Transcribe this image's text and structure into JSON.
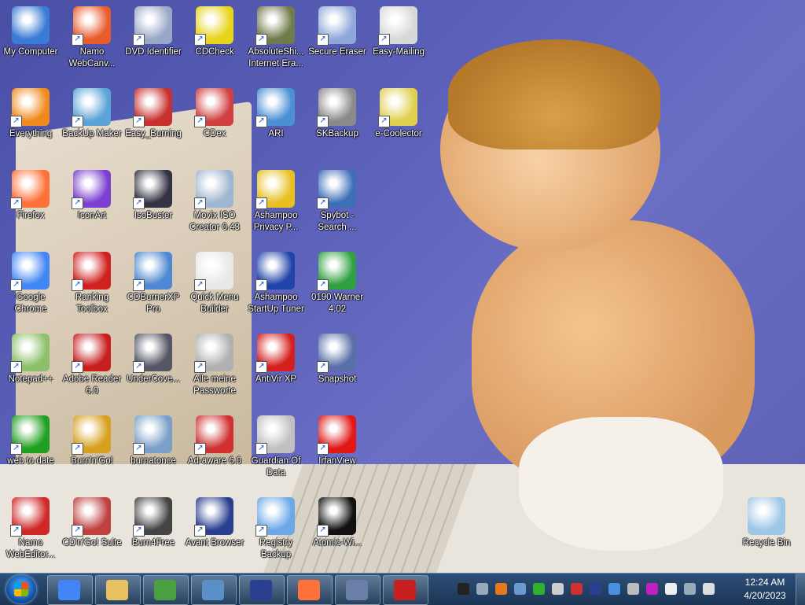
{
  "desktop": {
    "icons": [
      {
        "label": "My Computer",
        "icon": "computer-icon",
        "color": "#3a7bd5"
      },
      {
        "label": "Namo WebCanv...",
        "icon": "canvas-icon",
        "color": "#e85c2c"
      },
      {
        "label": "DVD Identifier",
        "icon": "dvd-icon",
        "color": "#9aa8c8"
      },
      {
        "label": "CDCheck",
        "icon": "cd-check-icon",
        "color": "#e8d41a"
      },
      {
        "label": "AbsoluteShi... Internet Era...",
        "icon": "shredder-icon",
        "color": "#6f7b4a"
      },
      {
        "label": "Secure Eraser",
        "icon": "printer-eraser-icon",
        "color": "#8ea9d9"
      },
      {
        "label": "Easy-Mailing",
        "icon": "mail-icon",
        "color": "#d8d8d8"
      },
      {
        "label": "Everything",
        "icon": "search-ring-icon",
        "color": "#f08a1c"
      },
      {
        "label": "BackUp Maker",
        "icon": "backup-icon",
        "color": "#5aa4d8"
      },
      {
        "label": "Easy_Burning",
        "icon": "burn-icon",
        "color": "#c83030"
      },
      {
        "label": "CDex",
        "icon": "cdex-icon",
        "color": "#d04040"
      },
      {
        "label": "ARI",
        "icon": "ari-icon",
        "color": "#4b8fd4"
      },
      {
        "label": "SKBackup",
        "icon": "hdd-icon",
        "color": "#8a8a8a"
      },
      {
        "label": "e-Coolector",
        "icon": "binoculars-icon",
        "color": "#e0d050"
      },
      {
        "label": "Firefox",
        "icon": "firefox-icon",
        "color": "#ff7139"
      },
      {
        "label": "IconArt",
        "icon": "iconart-icon",
        "color": "#7c3fd0"
      },
      {
        "label": "IsoBuster",
        "icon": "isobuster-icon",
        "color": "#333344"
      },
      {
        "label": "Movix ISO Creator 0.43",
        "icon": "movix-icon",
        "color": "#9fb6d0"
      },
      {
        "label": "Ashampoo Privacy P...",
        "icon": "privacy-icon",
        "color": "#e8c020"
      },
      {
        "label": "Spybot - Search ...",
        "icon": "spybot-icon",
        "color": "#3d6fb8"
      },
      {
        "label": "Google Chrome",
        "icon": "chrome-icon",
        "color": "#4285f4"
      },
      {
        "label": "Ranking Toolbox",
        "icon": "ranking-icon",
        "color": "#d02020"
      },
      {
        "label": "CDBurnerXP Pro",
        "icon": "cdburner-icon",
        "color": "#4d88d0"
      },
      {
        "label": "Quick Menu Builder",
        "icon": "qmb-icon",
        "color": "#e8e8e8"
      },
      {
        "label": "Ashampoo StartUp Tuner",
        "icon": "rocket-icon",
        "color": "#2244aa"
      },
      {
        "label": "0190 Warner 4.02",
        "icon": "warning-icon",
        "color": "#30a040"
      },
      {
        "label": "Notepad++",
        "icon": "notepad-icon",
        "color": "#8cc06a"
      },
      {
        "label": "Adobe Reader 6.0",
        "icon": "adobe-icon",
        "color": "#c81e1e"
      },
      {
        "label": "UnderCove...",
        "icon": "undercover-icon",
        "color": "#556"
      },
      {
        "label": "Alle meine Passworte",
        "icon": "key-icon",
        "color": "#b0b0b0"
      },
      {
        "label": "AntiVir XP",
        "icon": "antivir-icon",
        "color": "#d41f1f"
      },
      {
        "label": "Snapshot",
        "icon": "snapshot-icon",
        "color": "#5a6fa8"
      },
      {
        "label": "web to date",
        "icon": "web-icon",
        "color": "#20a020"
      },
      {
        "label": "Burn'n'Go!",
        "icon": "burngo-icon",
        "color": "#d8a020"
      },
      {
        "label": "burnatonce",
        "icon": "burnatonce-icon",
        "color": "#7aa0c8"
      },
      {
        "label": "Ad-aware 6.0",
        "icon": "adaware-icon",
        "color": "#d03030"
      },
      {
        "label": "Guardian Of Data",
        "icon": "guardian-icon",
        "color": "#c0c0c0"
      },
      {
        "label": "IrfanView",
        "icon": "irfan-icon",
        "color": "#e01818"
      },
      {
        "label": "Namo WebEditor...",
        "icon": "rubik-icon",
        "color": "#d02828"
      },
      {
        "label": "CD'n'Go! Suite",
        "icon": "cdngo-icon",
        "color": "#c04040"
      },
      {
        "label": "Burn4Free",
        "icon": "burn4free-icon",
        "color": "#444"
      },
      {
        "label": "Avant Browser",
        "icon": "avant-icon",
        "color": "#2a3f90"
      },
      {
        "label": "Registry Backup",
        "icon": "registry-icon",
        "color": "#6aa8e8"
      },
      {
        "label": "Atomic-Wi...",
        "icon": "atomic-icon",
        "color": "#111"
      },
      {
        "label": "Recycle Bin",
        "icon": "recycle-bin-icon",
        "color": "#9ec6e6"
      }
    ]
  },
  "taskbar": {
    "start_icon": "windows-start-icon",
    "pinned": [
      {
        "icon": "chrome-icon",
        "color": "#4285f4"
      },
      {
        "icon": "explorer-folder-icon",
        "color": "#e8c060"
      },
      {
        "icon": "checkmark-app-icon",
        "color": "#4aa040"
      },
      {
        "icon": "network-computer-icon",
        "color": "#5a8fc8"
      },
      {
        "icon": "avant-icon",
        "color": "#2a3f90"
      },
      {
        "icon": "firefox-icon",
        "color": "#ff7139"
      },
      {
        "icon": "ship-app-icon",
        "color": "#6a7fa8"
      },
      {
        "icon": "monitor-app-icon",
        "color": "#c82020"
      }
    ],
    "tray": [
      {
        "icon": "tray-shield-icon",
        "color": "#222"
      },
      {
        "icon": "tray-printer-icon",
        "color": "#9ab"
      },
      {
        "icon": "tray-search-icon",
        "color": "#e87820"
      },
      {
        "icon": "tray-network-icon",
        "color": "#6a9ad0"
      },
      {
        "icon": "tray-green-icon",
        "color": "#30b030"
      },
      {
        "icon": "tray-drive-icon",
        "color": "#ccc"
      },
      {
        "icon": "tray-stop-icon",
        "color": "#d03030"
      },
      {
        "icon": "tray-avant-icon",
        "color": "#2a3f90"
      },
      {
        "icon": "tray-dropbox-icon",
        "color": "#4a90e0"
      },
      {
        "icon": "tray-gear-icon",
        "color": "#bbb"
      },
      {
        "icon": "tray-umbrella-icon",
        "color": "#c020c0"
      },
      {
        "icon": "tray-flag-icon",
        "color": "#eee"
      },
      {
        "icon": "tray-monitor-icon",
        "color": "#9ab"
      },
      {
        "icon": "tray-volume-muted-icon",
        "color": "#ddd"
      }
    ],
    "clock": {
      "time": "12:24 AM",
      "date": "4/20/2023"
    }
  }
}
